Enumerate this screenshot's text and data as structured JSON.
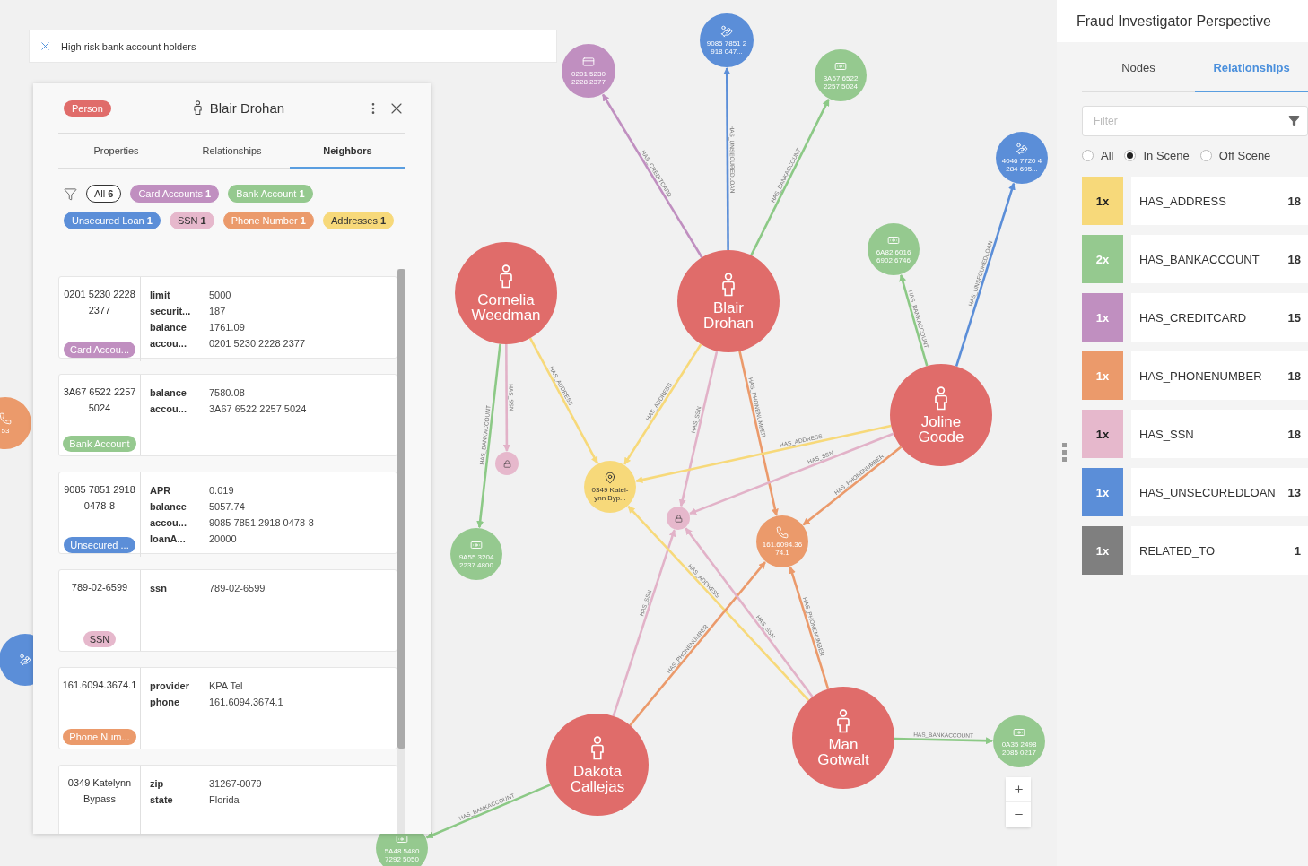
{
  "search": {
    "value": "High risk bank account holders"
  },
  "graph": {
    "nodes": [
      {
        "kind": "person",
        "label": "Cornelia Weedman"
      },
      {
        "kind": "person",
        "label": "Blair Drohan"
      },
      {
        "kind": "person",
        "label": "Joline Goode"
      },
      {
        "kind": "person",
        "label": "Dakota Callejas"
      },
      {
        "kind": "person",
        "label": "Man Gotwalt"
      },
      {
        "kind": "card",
        "label": "0201 5230 2228 2377"
      },
      {
        "kind": "loan",
        "label": "9085 7851 2 918 047..."
      },
      {
        "kind": "bank",
        "label": "3A67 6522 2257 5024"
      },
      {
        "kind": "bank",
        "label": "6A82 6016 6902 6746"
      },
      {
        "kind": "loan",
        "label": "4046 7720 4 284 695..."
      },
      {
        "kind": "address",
        "label": "0349 Katel-ynn Byp..."
      },
      {
        "kind": "ssn"
      },
      {
        "kind": "ssn"
      },
      {
        "kind": "phone",
        "label": "161.6094.36 74.1"
      },
      {
        "kind": "bank",
        "label": "9A55 3204 2237 4800"
      },
      {
        "kind": "bank",
        "label": "0A35 2498 2085 0217"
      },
      {
        "kind": "bank",
        "label": "5A48 5480 7292 5050"
      },
      {
        "kind": "phone",
        "label": "53"
      },
      {
        "kind": "loan"
      }
    ],
    "edges": [
      {
        "label": "HAS_CREDITCARD",
        "color": "#c08fc0"
      },
      {
        "label": "HAS_UNSECUREDLOAN",
        "color": "#5b8ed8"
      },
      {
        "label": "HAS_BANKACCOUNT",
        "color": "#8cc986"
      },
      {
        "label": "HAS_ADDRESS",
        "color": "#f7d97a"
      },
      {
        "label": "HAS_SSN",
        "color": "#e2b2c8"
      },
      {
        "label": "HAS_PHONENUMBER",
        "color": "#eb9a6b"
      },
      {
        "label": "HAS_BANKACCOUNT",
        "color": "#8cc986"
      },
      {
        "label": "HAS_SSN",
        "color": "#e2b2c8"
      },
      {
        "label": "HAS_ADDRESS",
        "color": "#f7d97a"
      },
      {
        "label": "HAS_BANKACCOUNT",
        "color": "#8cc986"
      },
      {
        "label": "HAS_UNSECUREDLOAN",
        "color": "#5b8ed8"
      },
      {
        "label": "HAS_ADDRESS",
        "color": "#f7d97a"
      },
      {
        "label": "HAS_SSN",
        "color": "#e2b2c8"
      },
      {
        "label": "HAS_PHONENUMBER",
        "color": "#eb9a6b"
      },
      {
        "label": "HAS_SSN",
        "color": "#e2b2c8"
      },
      {
        "label": "HAS_PHONENUMBER",
        "color": "#eb9a6b"
      },
      {
        "label": "HAS_BANKACCOUNT",
        "color": "#8cc986"
      },
      {
        "label": "HAS_ADDRESS",
        "color": "#f7d97a"
      },
      {
        "label": "HAS_SSN",
        "color": "#e2b2c8"
      },
      {
        "label": "HAS_PHONENUMBER",
        "color": "#eb9a6b"
      },
      {
        "label": "HAS_BANKACCOUNT",
        "color": "#8cc986"
      }
    ]
  },
  "detail": {
    "badge": "Person",
    "title": "Blair Drohan",
    "tabs": [
      {
        "label": "Properties",
        "selected": false
      },
      {
        "label": "Relationships",
        "selected": false
      },
      {
        "label": "Neighbors",
        "selected": true
      }
    ],
    "chips": [
      {
        "kind": "all",
        "label": "All",
        "count": "6"
      },
      {
        "kind": "type",
        "label": "Card Accounts",
        "count": "1",
        "color": "#c08fc0"
      },
      {
        "kind": "type",
        "label": "Bank Account",
        "count": "1",
        "color": "#95c98f"
      },
      {
        "kind": "type",
        "label": "Unsecured Loan",
        "count": "1",
        "color": "#5b8ed8"
      },
      {
        "kind": "type",
        "label": "SSN",
        "count": "1",
        "color": "#e6b8cc"
      },
      {
        "kind": "type",
        "label": "Phone Number",
        "count": "1",
        "color": "#eb9a6b"
      },
      {
        "kind": "type",
        "label": "Addresses",
        "count": "1",
        "color": "#f7d97a"
      }
    ],
    "neighbors": [
      {
        "title": "0201 5230 2228 2377",
        "tag": "Card Accou...",
        "color": "#c08fc0",
        "properties": [
          {
            "key": "limit",
            "value": "5000"
          },
          {
            "key": "securit...",
            "value": "187"
          },
          {
            "key": "balance",
            "value": "1761.09"
          },
          {
            "key": "accou...",
            "value": "0201 5230 2228 2377"
          }
        ]
      },
      {
        "title": "3A67 6522 2257 5024",
        "tag": "Bank Account",
        "color": "#95c98f",
        "properties": [
          {
            "key": "balance",
            "value": "7580.08"
          },
          {
            "key": "accou...",
            "value": "3A67 6522 2257 5024"
          }
        ]
      },
      {
        "title": "9085 7851 2918 0478-8",
        "tag": "Unsecured ...",
        "color": "#5b8ed8",
        "properties": [
          {
            "key": "APR",
            "value": "0.019"
          },
          {
            "key": "balance",
            "value": "5057.74"
          },
          {
            "key": "accou...",
            "value": "9085 7851 2918 0478-8"
          },
          {
            "key": "loanA...",
            "value": "20000"
          }
        ]
      },
      {
        "title": "789-02-6599",
        "tag": "SSN",
        "color": "#e6b8cc",
        "properties": [
          {
            "key": "ssn",
            "value": "789-02-6599"
          }
        ]
      },
      {
        "title": "161.6094.3674.1",
        "tag": "Phone Num...",
        "color": "#eb9a6b",
        "properties": [
          {
            "key": "provider",
            "value": "KPA Tel"
          },
          {
            "key": "phone",
            "value": "161.6094.3674.1"
          }
        ]
      },
      {
        "title": "0349 Katelynn Bypass",
        "properties": [
          {
            "key": "zip",
            "value": "31267-0079"
          },
          {
            "key": "state",
            "value": "Florida"
          }
        ]
      }
    ]
  },
  "sidebar": {
    "title": "Fraud Investigator Perspective",
    "tabs": [
      {
        "label": "Nodes",
        "selected": false
      },
      {
        "label": "Relationships",
        "selected": true
      }
    ],
    "filter": {
      "placeholder": "Filter"
    },
    "scope": [
      {
        "label": "All",
        "selected": false
      },
      {
        "label": "In Scene",
        "selected": true
      },
      {
        "label": "Off Scene",
        "selected": false
      }
    ],
    "relationships": [
      {
        "badge": "1x",
        "name": "HAS_ADDRESS",
        "count": "18",
        "color": "#f7d97a"
      },
      {
        "badge": "2x",
        "name": "HAS_BANKACCOUNT",
        "count": "18",
        "color": "#95c98f"
      },
      {
        "badge": "1x",
        "name": "HAS_CREDITCARD",
        "count": "15",
        "color": "#c08fc0"
      },
      {
        "badge": "1x",
        "name": "HAS_PHONENUMBER",
        "count": "18",
        "color": "#eb9a6b"
      },
      {
        "badge": "1x",
        "name": "HAS_SSN",
        "count": "18",
        "color": "#e6b8cc"
      },
      {
        "badge": "1x",
        "name": "HAS_UNSECUREDLOAN",
        "count": "13",
        "color": "#5b8ed8"
      },
      {
        "badge": "1x",
        "name": "RELATED_TO",
        "count": "1",
        "color": "#7f7f7f"
      }
    ]
  }
}
